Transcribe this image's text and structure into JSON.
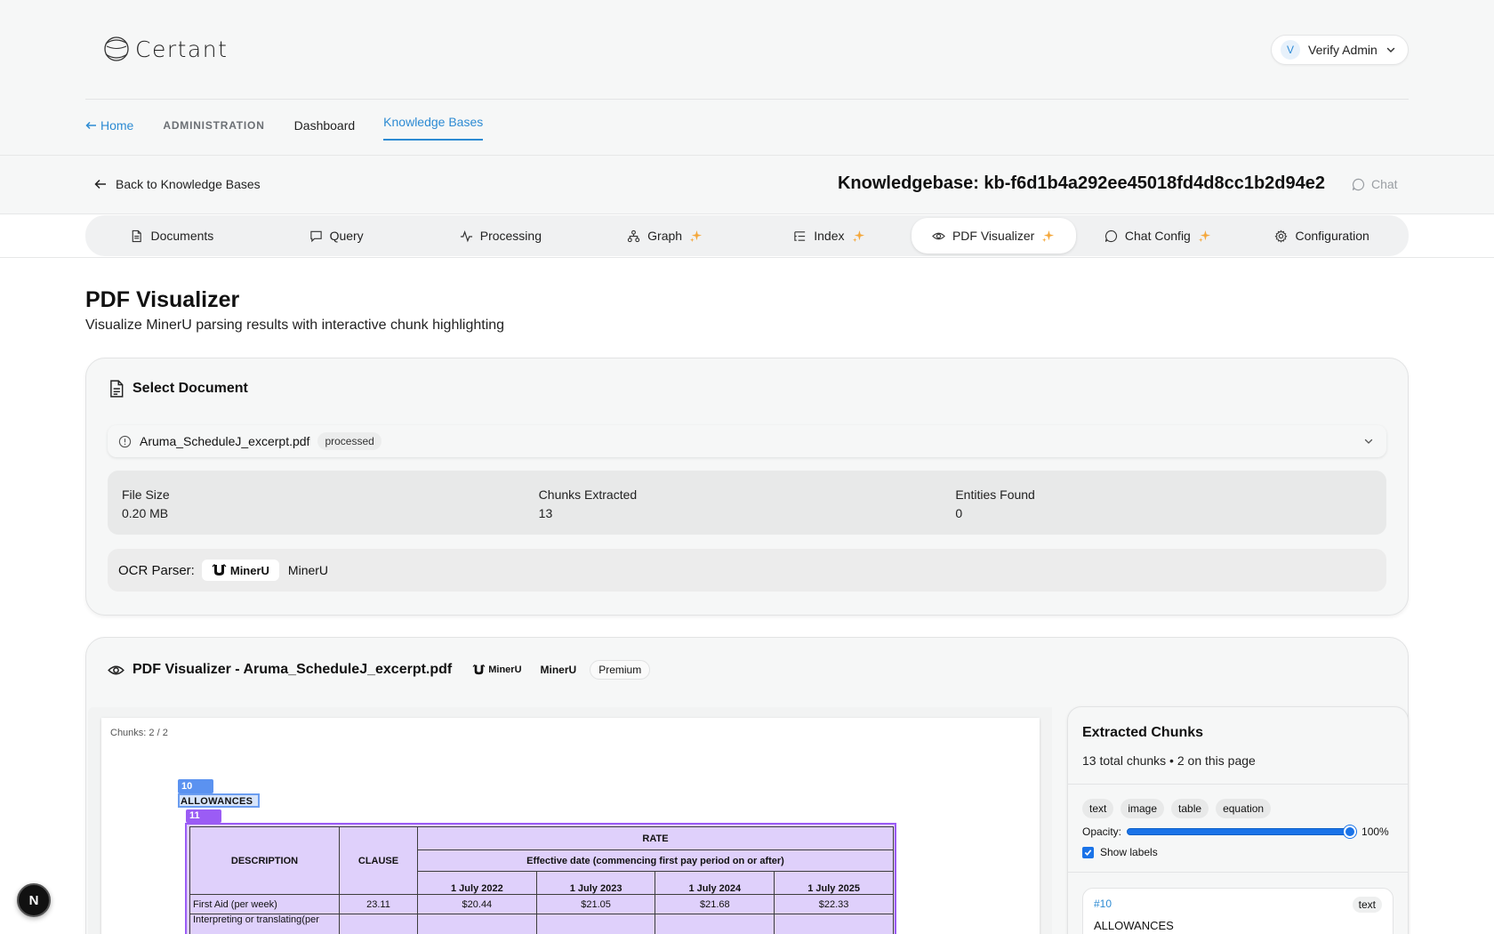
{
  "header": {
    "logo_text": "Certant",
    "user": {
      "initial": "V",
      "name": "Verify Admin"
    }
  },
  "nav": {
    "home": "Home",
    "admin": "ADMINISTRATION",
    "dashboard": "Dashboard",
    "knowledge_bases": "Knowledge Bases"
  },
  "kbbar": {
    "back": "Back to Knowledge Bases",
    "title": "Knowledgebase: kb-f6d1b4a292ee45018fd4d8cc1b2d94e2",
    "chat": "Chat"
  },
  "tabs": [
    {
      "label": "Documents",
      "icon": "document-icon"
    },
    {
      "label": "Query",
      "icon": "message-icon"
    },
    {
      "label": "Processing",
      "icon": "activity-icon"
    },
    {
      "label": "Graph",
      "icon": "network-icon",
      "sparkle": true
    },
    {
      "label": "Index",
      "icon": "list-tree-icon",
      "sparkle": true
    },
    {
      "label": "PDF Visualizer",
      "icon": "eye-icon",
      "sparkle": true,
      "active": true
    },
    {
      "label": "Chat Config",
      "icon": "message-icon",
      "sparkle": true
    },
    {
      "label": "Configuration",
      "icon": "gear-icon"
    }
  ],
  "page": {
    "title": "PDF Visualizer",
    "subtitle": "Visualize MinerU parsing results with interactive chunk highlighting"
  },
  "select_card": {
    "title": "Select Document",
    "selected_file": "Aruma_ScheduleJ_excerpt.pdf",
    "status": "processed",
    "stats": [
      {
        "label": "File Size",
        "value": "0.20 MB"
      },
      {
        "label": "Chunks Extracted",
        "value": "13"
      },
      {
        "label": "Entities Found",
        "value": "0"
      }
    ],
    "ocr_label": "OCR Parser:",
    "ocr_logo": "MinerU",
    "ocr_value": "MinerU"
  },
  "viz_card": {
    "title": "PDF Visualizer - Aruma_ScheduleJ_excerpt.pdf",
    "logo": "MinerU",
    "parser": "MinerU",
    "tier": "Premium",
    "chunks_counter": "Chunks: 2 / 2",
    "chunk10_label": "10",
    "chunk10_text": "ALLOWANCES",
    "chunk11_label": "11",
    "table": {
      "h_description": "DESCRIPTION",
      "h_clause": "CLAUSE",
      "h_rate": "RATE",
      "h_effective": "Effective date (commencing first pay period on or after)",
      "dates": [
        "1 July 2022",
        "1 July 2023",
        "1 July 2024",
        "1 July 2025"
      ],
      "rows": [
        {
          "description": "First Aid (per week)",
          "clause": "23.11",
          "values": [
            "$20.44",
            "$21.05",
            "$21.68",
            "$22.33"
          ]
        },
        {
          "description": "Interpreting or translating(per",
          "clause": "",
          "values": [
            "",
            "",
            "",
            ""
          ]
        }
      ]
    }
  },
  "chunks_panel": {
    "title": "Extracted Chunks",
    "summary": "13 total chunks • 2 on this page",
    "filters": [
      "text",
      "image",
      "table",
      "equation"
    ],
    "opacity_label": "Opacity:",
    "opacity_value": "100%",
    "opacity": 1.0,
    "show_labels": "Show labels",
    "show_labels_checked": true,
    "first_chunk": {
      "id": "#10",
      "type": "text",
      "text": "ALLOWANCES"
    }
  },
  "next_badge": "N",
  "colors": {
    "accent": "#2d8bd3",
    "chunk_text": "#5b92f0",
    "chunk_table": "#9b5cf5",
    "sparkle": "#f4a73a"
  }
}
